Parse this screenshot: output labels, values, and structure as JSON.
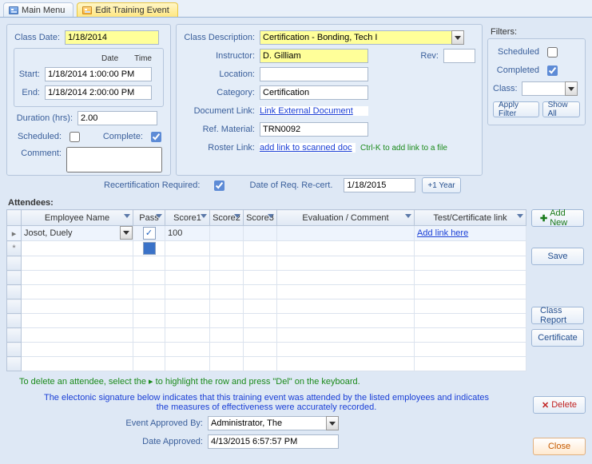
{
  "tabs": {
    "main": "Main Menu",
    "edit": "Edit Training Event"
  },
  "left": {
    "class_date_label": "Class Date:",
    "class_date": "1/18/2014",
    "date_hdr": "Date",
    "time_hdr": "Time",
    "start_label": "Start:",
    "start_value": "1/18/2014 1:00:00 PM",
    "end_label": "End:",
    "end_value": "1/18/2014 2:00:00 PM",
    "duration_label": "Duration (hrs):",
    "duration_value": "2.00",
    "scheduled_label": "Scheduled:",
    "complete_label": "Complete:",
    "comment_label": "Comment:",
    "comment_value": ""
  },
  "mid": {
    "class_desc_label": "Class Description:",
    "class_desc_value": "Certification - Bonding, Tech I",
    "instructor_label": "Instructor:",
    "instructor_value": "D. Gilliam",
    "rev_label": "Rev:",
    "rev_value": "",
    "location_label": "Location:",
    "location_value": "",
    "category_label": "Category:",
    "category_value": "Certification",
    "doclink_label": "Document Link:",
    "doclink_text": "Link  External  Document",
    "refmat_label": "Ref. Material:",
    "refmat_value": "TRN0092",
    "rosterlink_label": "Roster Link:",
    "rosterlink_text": "add link to scanned doc",
    "rosterlink_hint": "Ctrl-K to add link to a file"
  },
  "filters": {
    "header": "Filters:",
    "scheduled_label": "Scheduled",
    "completed_label": "Completed",
    "class_label": "Class:",
    "class_value": "",
    "apply_btn": "Apply Filter",
    "showall_btn": "Show All"
  },
  "recert": {
    "req_label": "Recertification Required:",
    "date_label": "Date of Req. Re-cert.",
    "date_value": "1/18/2015",
    "plus1_btn": "+1 Year"
  },
  "attendees": {
    "header": "Attendees:",
    "columns": {
      "emp": "Employee Name",
      "pass": "Pass",
      "score1": "Score1",
      "score2": "Score2",
      "score3": "Score3",
      "eval": "Evaluation / Comment",
      "cert": "Test/Certificate link"
    },
    "rows": [
      {
        "emp": "Josot, Duely",
        "pass": true,
        "score1": "100",
        "score2": "",
        "score3": "",
        "eval": "",
        "cert": "Add link here"
      }
    ],
    "add_new_btn": "Add New",
    "save_btn": "Save",
    "class_report_btn": "Class Report",
    "certificate_btn": "Certificate",
    "delete_hint": "To delete an attendee, select the  ▸  to highlight the row and press \"Del\" on the keyboard."
  },
  "signature": {
    "text": "The electonic signature below indicates that this training event was attended by the listed employees and indicates the measures of effectiveness were accurately recorded.",
    "approved_by_label": "Event Approved By:",
    "approved_by_value": "Administrator, The",
    "date_approved_label": "Date Approved:",
    "date_approved_value": "4/13/2015 6:57:57 PM"
  },
  "actions": {
    "delete_btn": "Delete",
    "close_btn": "Close"
  }
}
